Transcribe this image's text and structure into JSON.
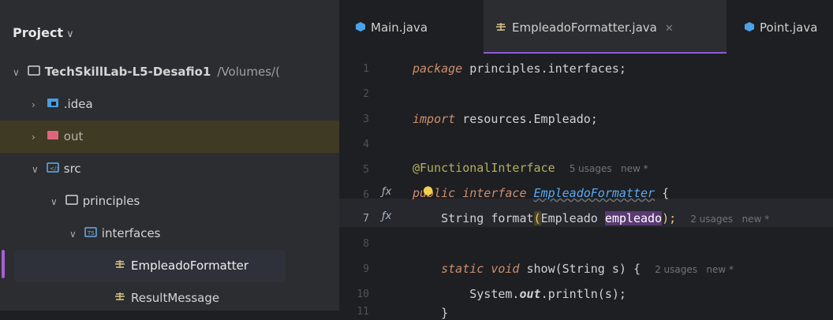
{
  "sidebar": {
    "header": "Project",
    "items": [
      {
        "label": "TechSkillLab-L5-Desafio1",
        "extra": "/Volumes/("
      },
      {
        "label": ".idea"
      },
      {
        "label": "out"
      },
      {
        "label": "src"
      },
      {
        "label": "principles"
      },
      {
        "label": "interfaces"
      },
      {
        "label": "EmpleadoFormatter"
      },
      {
        "label": "ResultMessage"
      }
    ]
  },
  "tabs": [
    {
      "label": "Main.java"
    },
    {
      "label": "EmpleadoFormatter.java"
    },
    {
      "label": "Point.java"
    }
  ],
  "editor": {
    "lines": [
      "1",
      "2",
      "3",
      "4",
      "5",
      "6",
      "7",
      "8",
      "9",
      "10",
      "11"
    ],
    "l1_kw": "package",
    "l1_rest": " principles.interfaces;",
    "l3_kw": "import",
    "l3_rest": " resources.Empleado;",
    "l5_ann": "@FunctionalInterface",
    "l5_hint": "5 usages   new *",
    "l6_kw1": "public",
    "l6_kw2": "interface",
    "l6_id": "EmpleadoFormatter",
    "l6_rest": " {",
    "l7_a": "String format",
    "l7_b": "(",
    "l7_c": "Empleado ",
    "l7_d": "empleado",
    "l7_e": ");",
    "l7_hint": "2 usages   new *",
    "l9_kw1": "static",
    "l9_kw2": "void",
    "l9_rest": " show(String s) {",
    "l9_hint": "2 usages   new *",
    "l10_a": "System.",
    "l10_b": "out",
    "l10_c": ".println(s);",
    "l11": "}"
  }
}
